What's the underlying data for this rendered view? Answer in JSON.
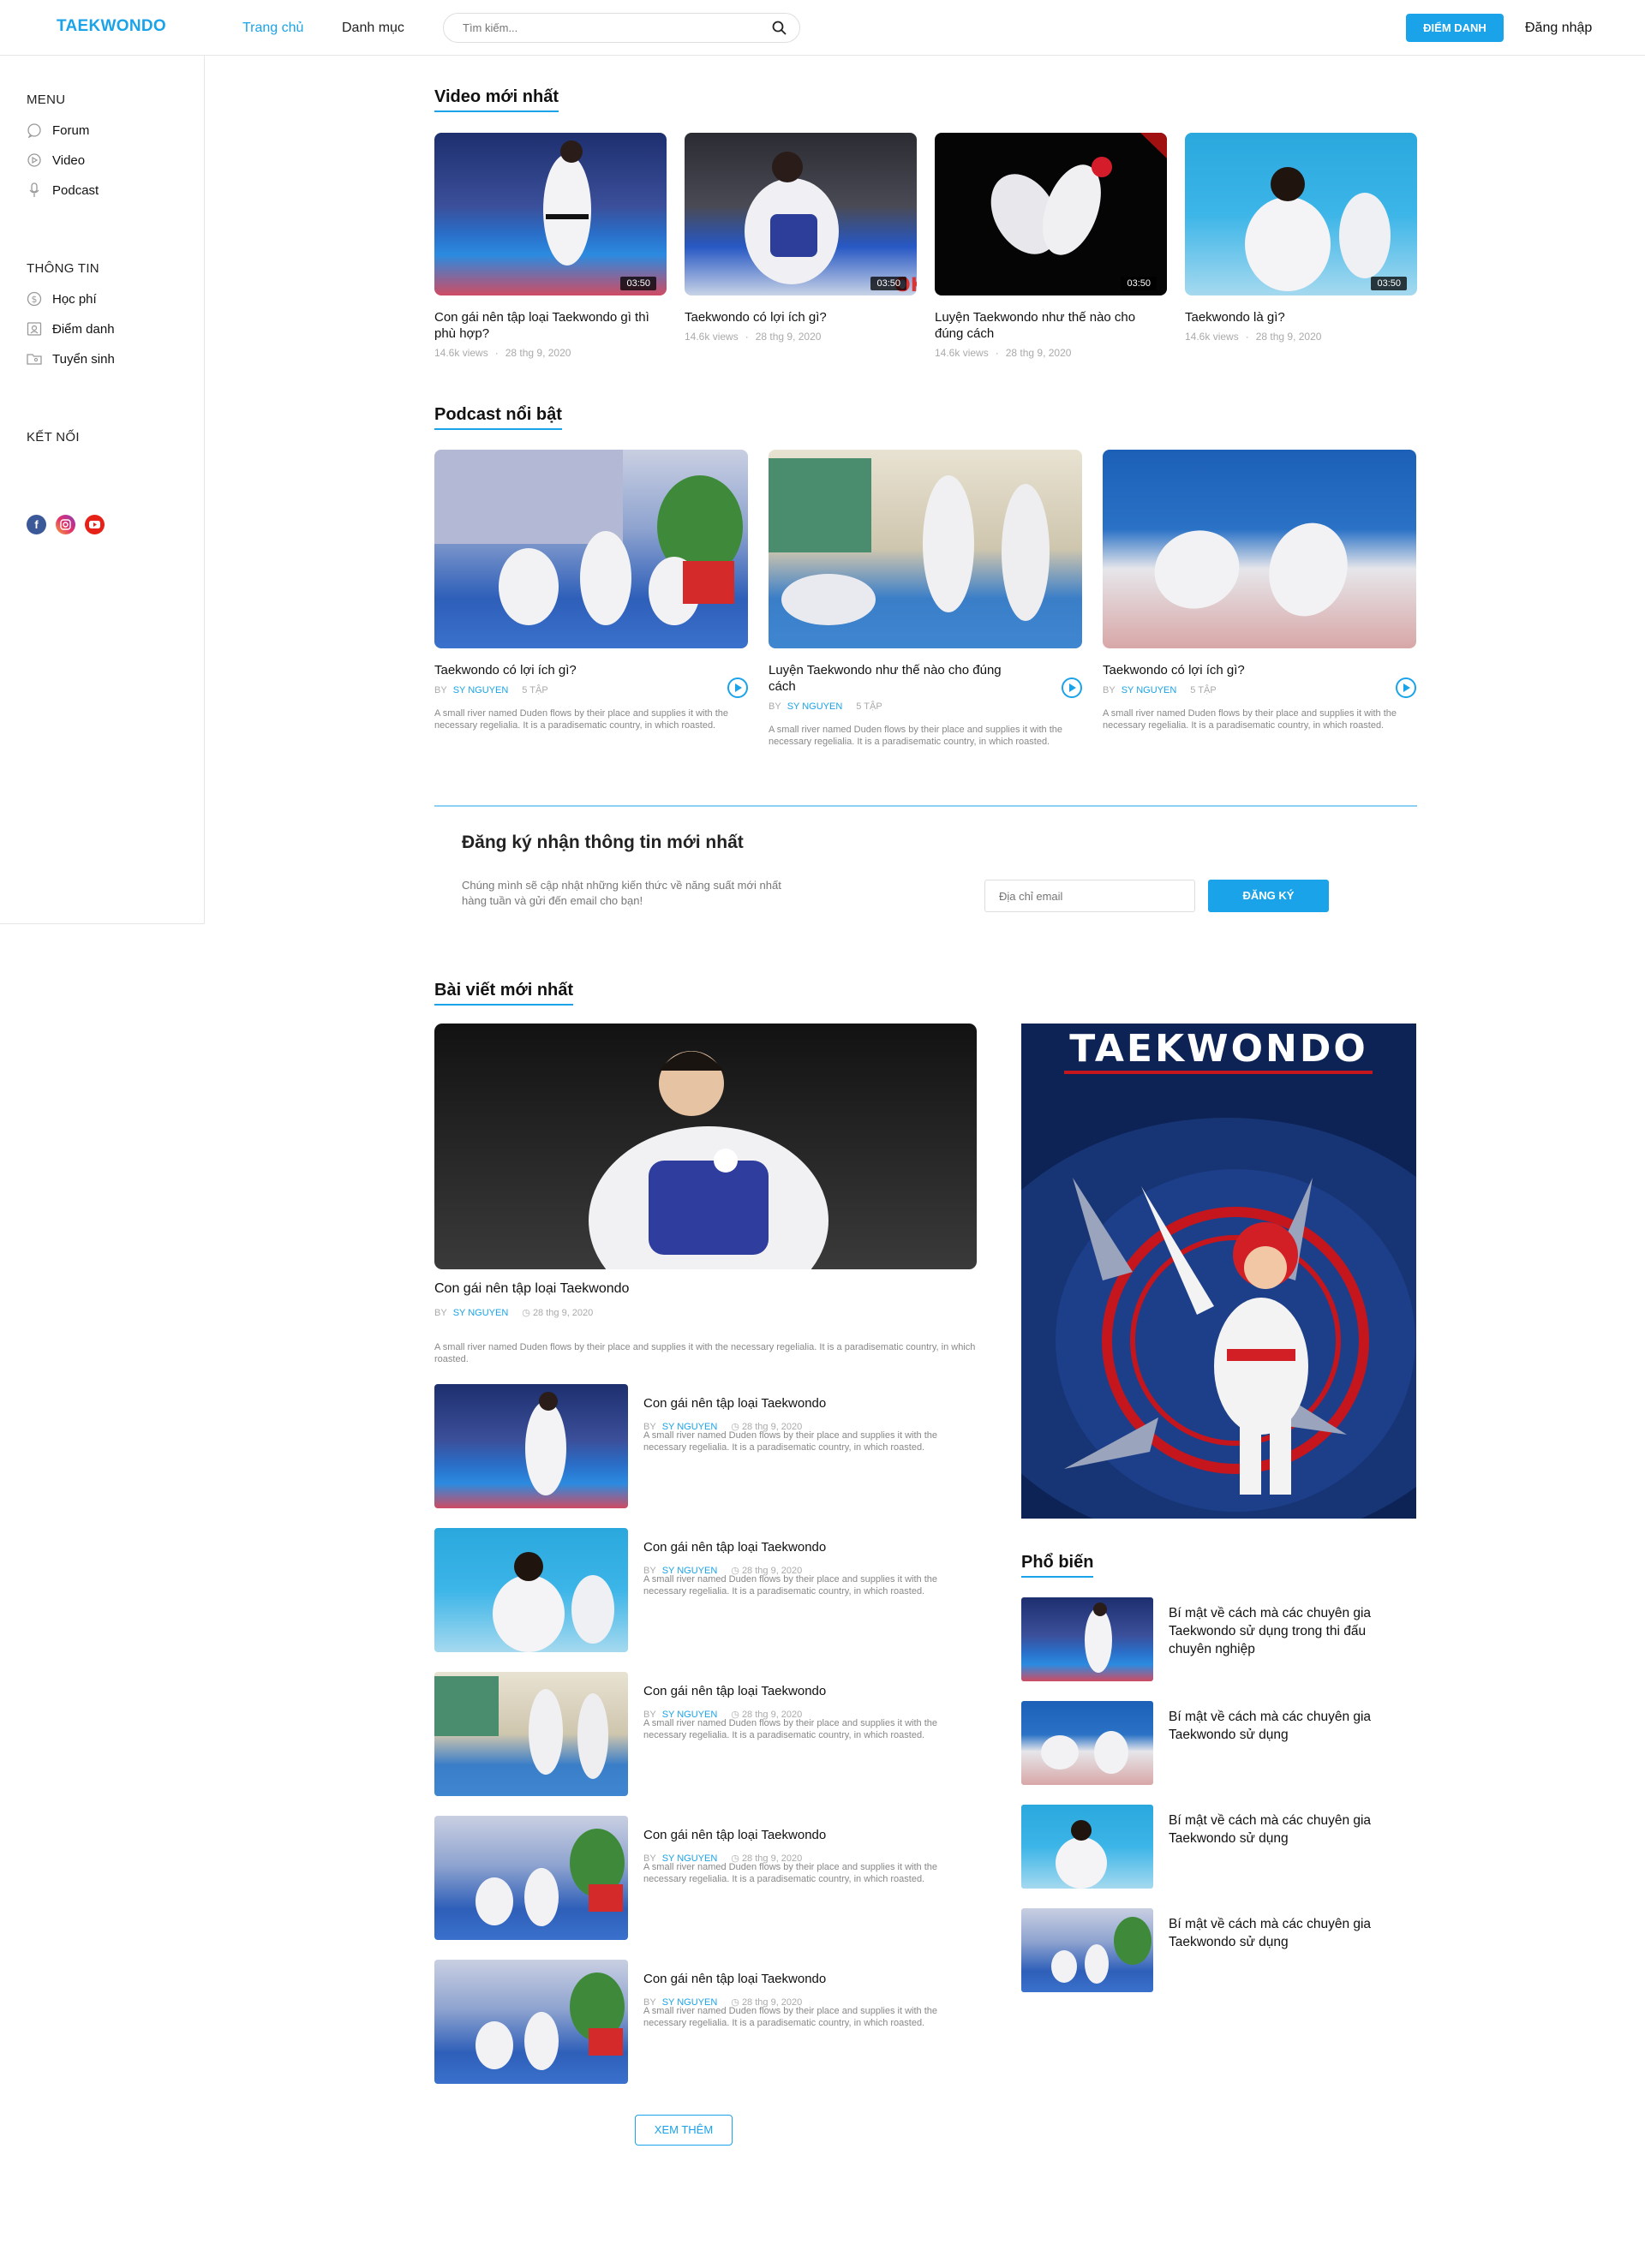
{
  "header": {
    "logo": "TAEKWONDO",
    "nav": [
      "Trang chủ",
      "Danh mục"
    ],
    "search_placeholder": "Tìm kiếm...",
    "checkin_button": "ĐIỂM DANH",
    "login": "Đăng nhập",
    "colors": {
      "accent": "#1aa3e8"
    }
  },
  "sidebar": {
    "menu_title": "MENU",
    "menu": [
      {
        "label": "Forum",
        "icon": "chat-bubble-icon"
      },
      {
        "label": "Video",
        "icon": "play-circle-icon"
      },
      {
        "label": "Podcast",
        "icon": "microphone-icon"
      }
    ],
    "info_title": "THÔNG TIN",
    "info": [
      {
        "label": "Học phí",
        "icon": "dollar-coin-icon"
      },
      {
        "label": "Điểm danh",
        "icon": "id-card-icon"
      },
      {
        "label": "Tuyển sinh",
        "icon": "folder-user-icon"
      }
    ],
    "connect_title": "KẾT NỐI",
    "social": [
      "facebook-icon",
      "instagram-icon",
      "youtube-icon"
    ]
  },
  "videos": {
    "title": "Video mới nhất",
    "items": [
      {
        "title": "Con gái nên tập loại Taekwondo gì thì phù hợp?",
        "duration": "03:50",
        "views": "14.6k views",
        "date": "28 thg 9, 2020"
      },
      {
        "title": "Taekwondo có lợi ích gì?",
        "duration": "03:50",
        "views": "14.6k views",
        "date": "28 thg 9, 2020"
      },
      {
        "title": "Luyện Taekwondo như thế nào cho đúng cách",
        "duration": "03:50",
        "views": "14.6k views",
        "date": "28 thg 9, 2020"
      },
      {
        "title": "Taekwondo là gì?",
        "duration": "03:50",
        "views": "14.6k views",
        "date": "28 thg 9, 2020"
      }
    ]
  },
  "podcasts": {
    "title": "Podcast nổi bật",
    "items": [
      {
        "title": "Taekwondo có lợi ích gì?",
        "by": "BY",
        "author": "SY NGUYEN",
        "episodes": "5 TẬP",
        "desc": "A small river named Duden flows by their place and supplies it with the necessary regelialia. It is a paradisematic country, in which roasted."
      },
      {
        "title": "Luyện Taekwondo như thế nào cho đúng cách",
        "by": "BY",
        "author": "SY NGUYEN",
        "episodes": "5 TẬP",
        "desc": "A small river named Duden flows by their place and supplies it with the necessary regelialia. It is a paradisematic country, in which roasted."
      },
      {
        "title": "Taekwondo có lợi ích gì?",
        "by": "BY",
        "author": "SY NGUYEN",
        "episodes": "5 TẬP",
        "desc": "A small river named Duden flows by their place and supplies it with the necessary regelialia. It is a paradisematic country, in which roasted."
      }
    ]
  },
  "subscribe": {
    "title": "Đăng ký nhận thông tin mới nhất",
    "text": "Chúng mình sẽ cập nhật những kiến thức về năng suất mới nhất hàng tuần và gửi đến email cho bạn!",
    "placeholder": "Địa chỉ email",
    "button": "ĐĂNG KÝ"
  },
  "articles": {
    "title": "Bài viết mới nhất",
    "featured": {
      "title": "Con gái nên tập loại Taekwondo",
      "by": "BY",
      "author": "SY NGUYEN",
      "date": "28 thg 9, 2020",
      "desc": "A small river named Duden flows by their place and supplies it with the necessary regelialia. It is a paradisematic country, in which roasted."
    },
    "items": [
      {
        "title": "Con gái nên tập loại Taekwondo",
        "by": "BY",
        "author": "SY NGUYEN",
        "date": "28 thg 9, 2020",
        "desc": "A small river named Duden flows by their place and supplies it with the necessary regelialia. It is a paradisematic country, in which roasted."
      },
      {
        "title": "Con gái nên tập loại Taekwondo",
        "by": "BY",
        "author": "SY NGUYEN",
        "date": "28 thg 9, 2020",
        "desc": "A small river named Duden flows by their place and supplies it with the necessary regelialia. It is a paradisematic country, in which roasted."
      },
      {
        "title": "Con gái nên tập loại Taekwondo",
        "by": "BY",
        "author": "SY NGUYEN",
        "date": "28 thg 9, 2020",
        "desc": "A small river named Duden flows by their place and supplies it with the necessary regelialia. It is a paradisematic country, in which roasted."
      },
      {
        "title": "Con gái nên tập loại Taekwondo",
        "by": "BY",
        "author": "SY NGUYEN",
        "date": "28 thg 9, 2020",
        "desc": "A small river named Duden flows by their place and supplies it with the necessary regelialia. It is a paradisematic country, in which roasted."
      },
      {
        "title": "Con gái nên tập loại Taekwondo",
        "by": "BY",
        "author": "SY NGUYEN",
        "date": "28 thg 9, 2020",
        "desc": "A small river named Duden flows by their place and supplies it with the necessary regelialia. It is a paradisematic country, in which roasted."
      }
    ],
    "more_button": "XEM THÊM"
  },
  "poster": {
    "text": "TAEKWONDO"
  },
  "popular": {
    "title": "Phổ biến",
    "items": [
      "Bí mật về cách mà các chuyên gia Taekwondo sử dụng trong thi đấu chuyên nghiệp",
      "Bí mật về cách mà các chuyên gia Taekwondo sử dụng",
      "Bí mật về cách mà các chuyên gia Taekwondo sử dụng",
      "Bí mật về cách mà các chuyên gia Taekwondo sử dụng"
    ]
  }
}
